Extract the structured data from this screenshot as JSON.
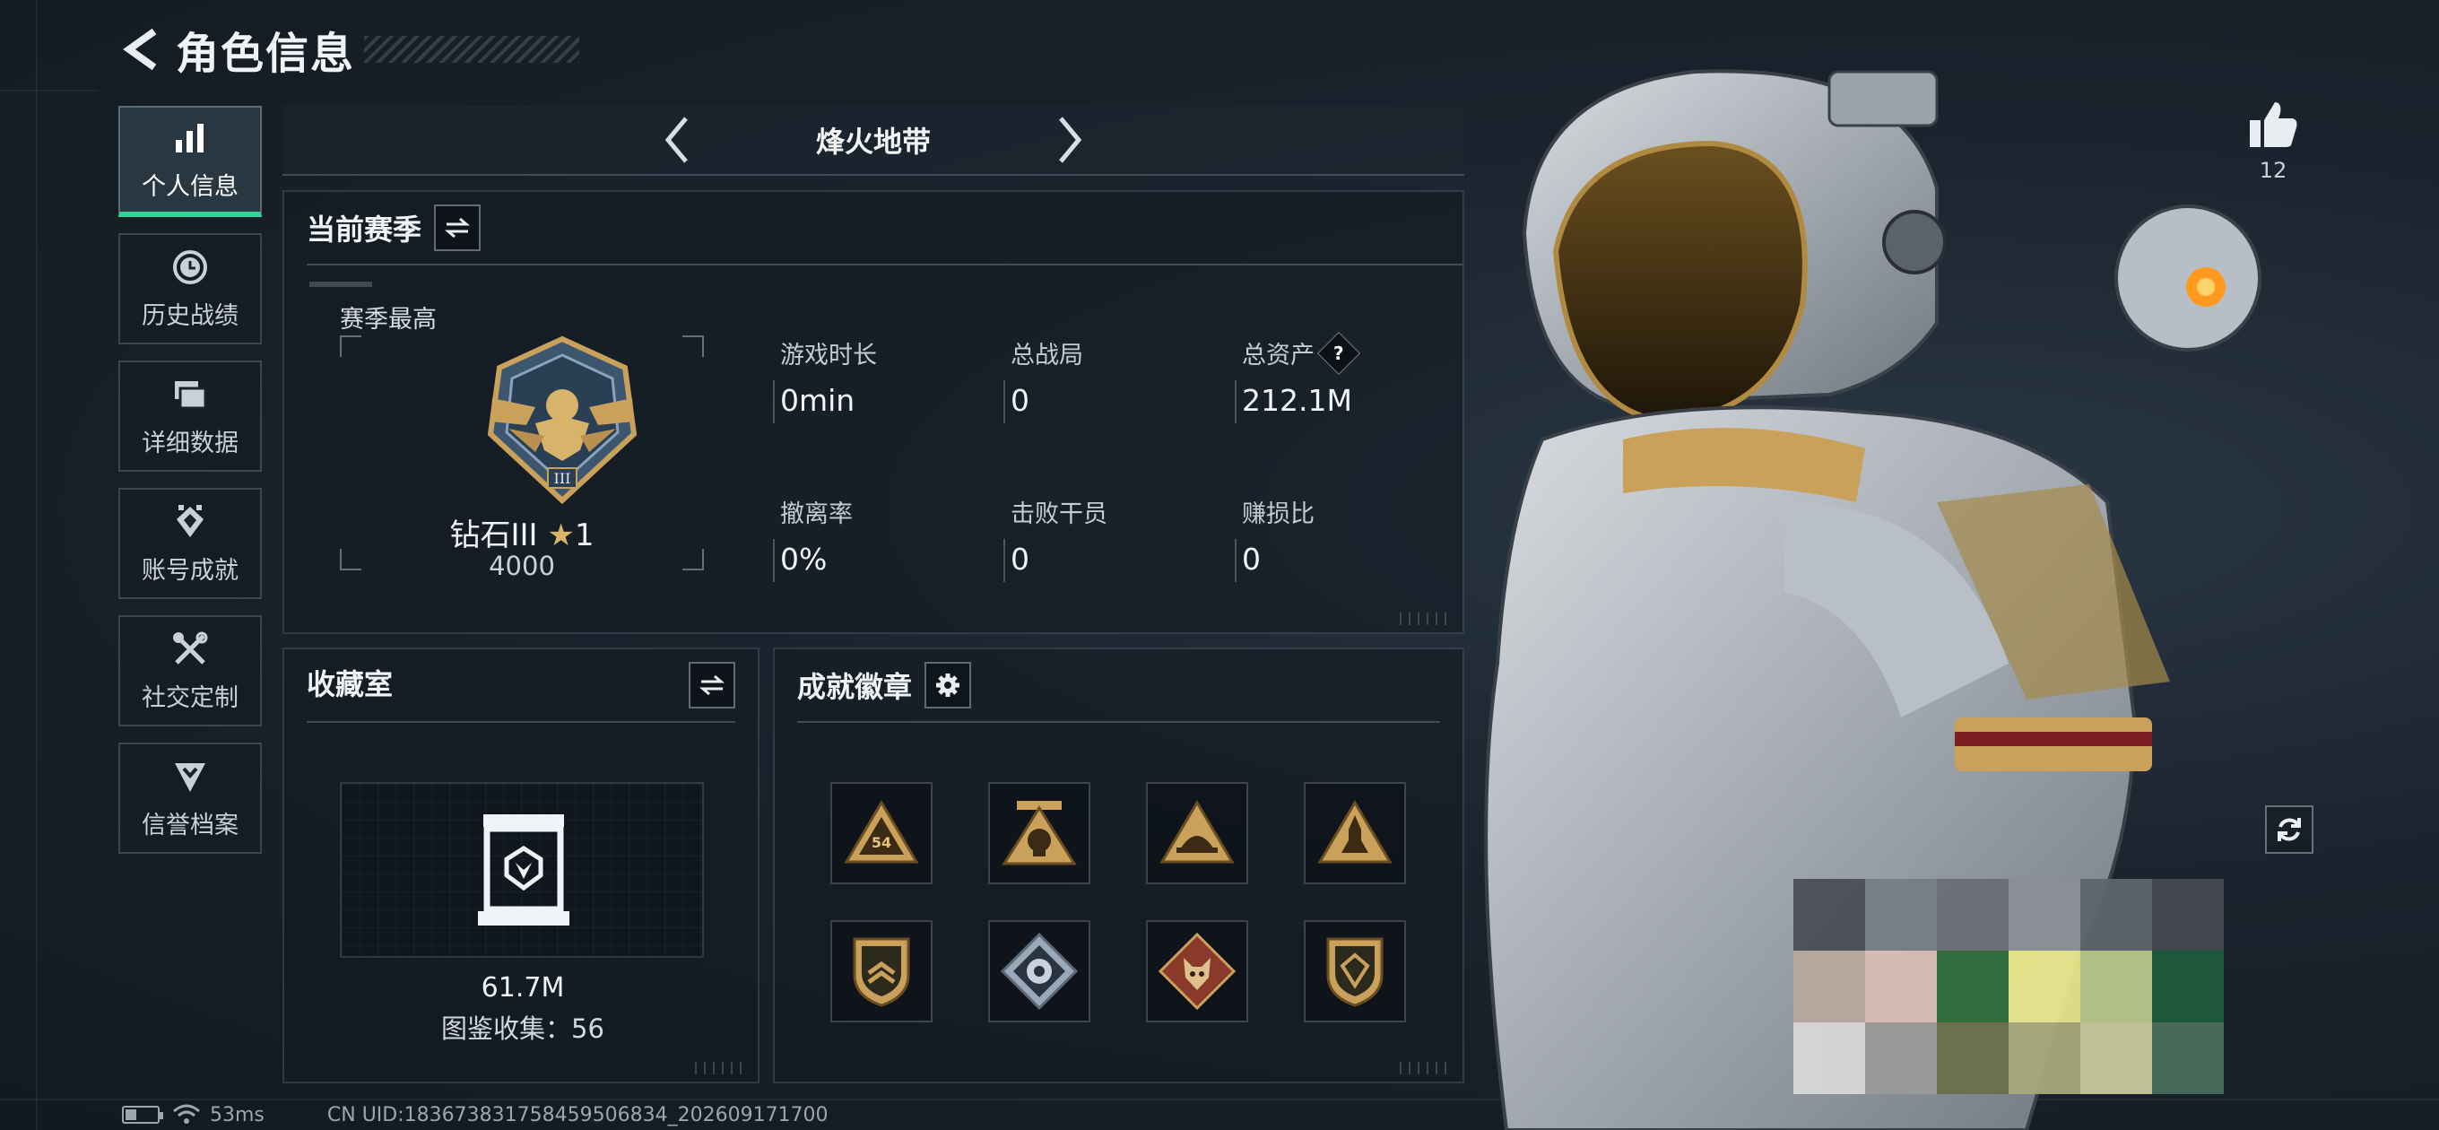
{
  "header": {
    "title": "角色信息"
  },
  "sidebar": {
    "items": [
      {
        "label": "个人信息",
        "icon": "bar-chart-icon",
        "active": true
      },
      {
        "label": "历史战绩",
        "icon": "clock-history-icon"
      },
      {
        "label": "详细数据",
        "icon": "folders-icon"
      },
      {
        "label": "账号成就",
        "icon": "achievement-icon"
      },
      {
        "label": "社交定制",
        "icon": "tools-icon"
      },
      {
        "label": "信誉档案",
        "icon": "shield-arrow-icon"
      }
    ]
  },
  "mode": {
    "name": "烽火地带"
  },
  "season": {
    "title": "当前赛季",
    "best_label": "赛季最高",
    "rank_name": "钻石III",
    "rank_stars": "1",
    "rank_score": "4000",
    "stats": [
      {
        "label": "游戏时长",
        "value": "0min"
      },
      {
        "label": "总战局",
        "value": "0"
      },
      {
        "label": "总资产",
        "value": "212.1M",
        "help": "?"
      },
      {
        "label": "撤离率",
        "value": "0%"
      },
      {
        "label": "击败干员",
        "value": "0"
      },
      {
        "label": "赚损比",
        "value": "0"
      }
    ]
  },
  "collection": {
    "title": "收藏室",
    "value": "61.7M",
    "count_text": "图鉴收集：56"
  },
  "badges": {
    "title": "成就徽章",
    "items": [
      {
        "icon": "triangle-badge-54-icon"
      },
      {
        "icon": "triangle-badge-skull-icon"
      },
      {
        "icon": "triangle-badge-helmet-icon"
      },
      {
        "icon": "triangle-badge-rocket-icon"
      },
      {
        "icon": "shield-badge-chevron-icon"
      },
      {
        "icon": "diamond-badge-flower-icon"
      },
      {
        "icon": "diamond-badge-wolf-icon"
      },
      {
        "icon": "shield-badge-gem-icon"
      }
    ]
  },
  "social": {
    "like_count": "12"
  },
  "footer": {
    "ping": "53ms",
    "uid": "CN UID:1836738317584595068​34_202609171700"
  },
  "colors": {
    "accent": "#35d29a",
    "gold": "#c9a15a",
    "panel_border": "#8fa2b0"
  }
}
